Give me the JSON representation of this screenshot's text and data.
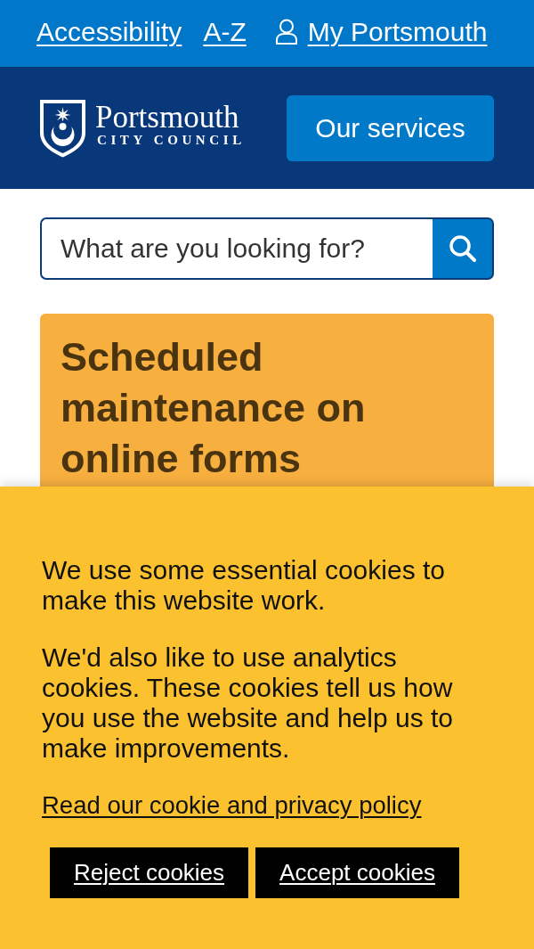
{
  "top_links": [
    {
      "label": "Accessibility",
      "kind": "link"
    },
    {
      "label": "A-Z",
      "kind": "link"
    },
    {
      "label": "My Portsmouth",
      "kind": "account"
    }
  ],
  "header": {
    "logo": {
      "name": "Portsmouth",
      "subtitle": "CITY COUNCIL"
    },
    "menu_button": "Our services"
  },
  "search": {
    "placeholder": "What are you looking for?"
  },
  "alert": {
    "title": "Scheduled maintenance on online forms"
  },
  "cookie_banner": {
    "paragraphs": [
      "We use some essential cookies to make this website work.",
      "We'd also like to use analytics cookies. These cookies tell us how you use the website and help us to make improvements."
    ],
    "policy_link": "Read our cookie and privacy policy",
    "buttons": [
      {
        "label": "Reject cookies"
      },
      {
        "label": "Accept cookies"
      }
    ]
  }
}
